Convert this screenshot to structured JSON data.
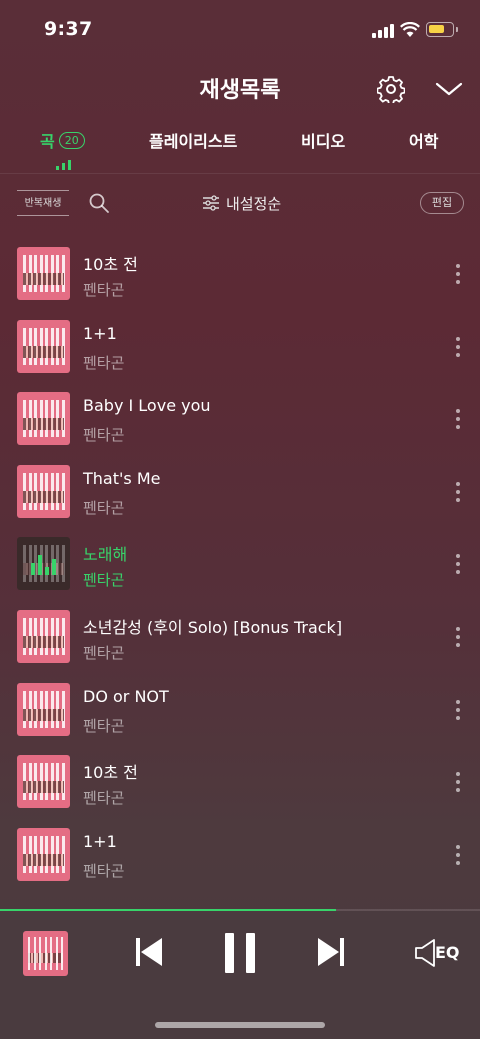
{
  "status_bar": {
    "time": "9:37"
  },
  "header": {
    "title": "재생목록"
  },
  "tabs": [
    {
      "label": "곡",
      "badge": "20",
      "active": true
    },
    {
      "label": "플레이리스트"
    },
    {
      "label": "비디오"
    },
    {
      "label": "어학"
    }
  ],
  "toolbar": {
    "repeat_label": "반복재생",
    "sort_label": "내설정순",
    "edit_label": "편집"
  },
  "songs": [
    {
      "title": "10초 전",
      "artist": "펜타곤"
    },
    {
      "title": "1+1",
      "artist": "펜타곤"
    },
    {
      "title": "Baby I Love you",
      "artist": "펜타곤"
    },
    {
      "title": "That's Me",
      "artist": "펜타곤"
    },
    {
      "title": "노래해",
      "artist": "펜타곤",
      "playing": true
    },
    {
      "title": "소년감성 (후이 Solo) [Bonus Track]",
      "artist": "펜타곤"
    },
    {
      "title": "DO or NOT",
      "artist": "펜타곤"
    },
    {
      "title": "10초 전",
      "artist": "펜타곤"
    },
    {
      "title": "1+1",
      "artist": "펜타곤"
    }
  ],
  "player": {
    "progress": 0.7,
    "eq_label": "EQ"
  },
  "colors": {
    "accent": "#38d36a",
    "album_pink": "#e46d84"
  }
}
